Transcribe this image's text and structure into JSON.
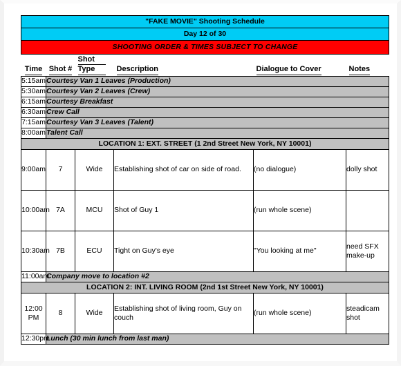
{
  "document": {
    "title": "\"FAKE MOVIE\" Shooting Schedule",
    "day_line": "Day 12 of 30",
    "notice": "SHOOTING ORDER & TIMES SUBJECT TO CHANGE",
    "colors": {
      "banner_cyan": "#00CCF5",
      "banner_red": "#FF0000",
      "row_grey": "#C0C0C0"
    }
  },
  "columns": {
    "time": "Time",
    "shot_number": "Shot #",
    "shot_type_line1": "Shot",
    "shot_type_line2": "Type",
    "description": "Description",
    "dialogue": "Dialogue to Cover",
    "notes": "Notes"
  },
  "calls": [
    {
      "time": "5:15am",
      "text": "Courtesy Van 1 Leaves (Production)"
    },
    {
      "time": "5:30am",
      "text": "Courtesy Van 2 Leaves (Crew)"
    },
    {
      "time": "6:15am",
      "text": "Courtesy Breakfast"
    },
    {
      "time": "6:30am",
      "text": "Crew Call"
    },
    {
      "time": "7:15am",
      "text": "Courtesy Van 3 Leaves (Talent)"
    },
    {
      "time": "8:00am",
      "text": "Talent Call"
    }
  ],
  "location_1": {
    "banner": "LOCATION 1: EXT. STREET (1 2nd Street New York, NY 10001)",
    "shots": [
      {
        "time": "9:00am",
        "shot_number": "7",
        "shot_type": "Wide",
        "description": "Establishing shot of car on side of road.",
        "dialogue": "(no dialogue)",
        "notes": "dolly shot"
      },
      {
        "time": "10:00am",
        "shot_number": "7A",
        "shot_type": "MCU",
        "description": "Shot of Guy 1",
        "dialogue": "(run whole scene)",
        "notes": ""
      },
      {
        "time": "10:30am",
        "shot_number": "7B",
        "shot_type": "ECU",
        "description": "Tight on Guy's eye",
        "dialogue": "\"You looking at me\"",
        "notes": "need SFX make-up"
      }
    ]
  },
  "company_move": {
    "time": "11:00am",
    "text": "Company move to location #2"
  },
  "location_2": {
    "banner": "LOCATION 2: INT. LIVING ROOM (2nd 1st Street New York, NY 10001)",
    "shots": [
      {
        "time": "12:00 PM",
        "shot_number": "8",
        "shot_type": "Wide",
        "description": "Establishing shot of living room, Guy on couch",
        "dialogue": "(run whole scene)",
        "notes": "steadicam shot"
      }
    ]
  },
  "lunch": {
    "time": "12:30pm",
    "text": "Lunch (30 min lunch from last man)"
  }
}
